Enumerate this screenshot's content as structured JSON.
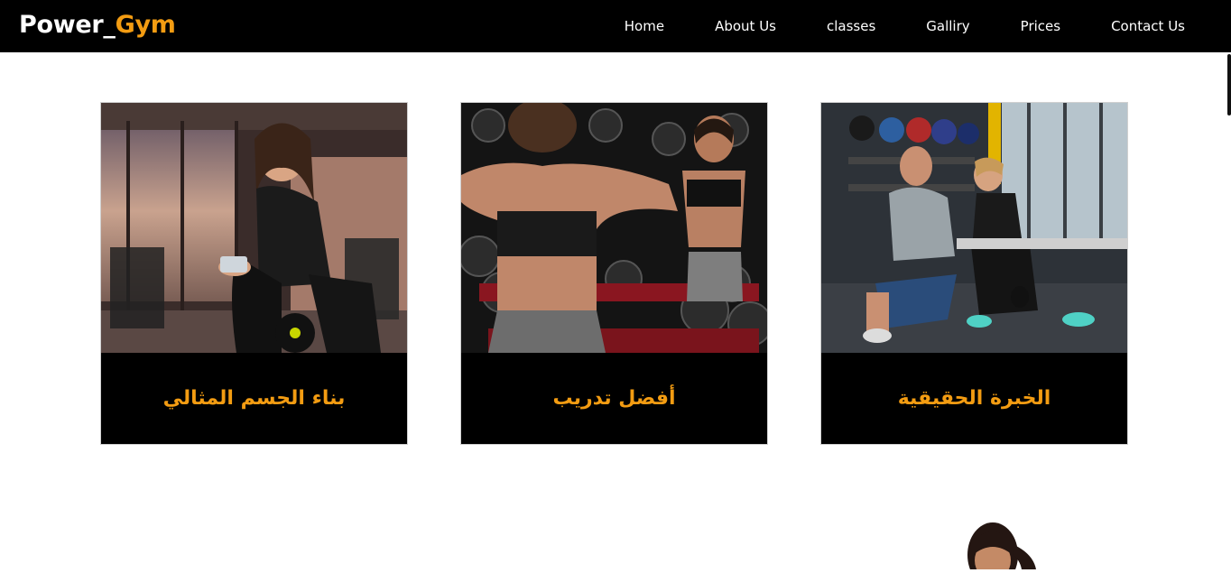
{
  "logo": {
    "part1": "Power_",
    "part2": "Gym"
  },
  "nav": [
    {
      "label": "Home"
    },
    {
      "label": "About Us"
    },
    {
      "label": "classes"
    },
    {
      "label": "Galliry"
    },
    {
      "label": "Prices"
    },
    {
      "label": "Contact Us"
    }
  ],
  "cards": [
    {
      "caption": "بناء الجسم المثالي",
      "image": "woman-with-phone-and-dumbbell-photo"
    },
    {
      "caption": "أفضل تدريب",
      "image": "woman-flexing-in-mirror-photo"
    },
    {
      "caption": "الخبرة الحقيقية",
      "image": "trainer-assisting-woman-photo"
    }
  ],
  "colors": {
    "accent": "#f39c12",
    "navbar": "#000000",
    "background": "#ffffff"
  }
}
